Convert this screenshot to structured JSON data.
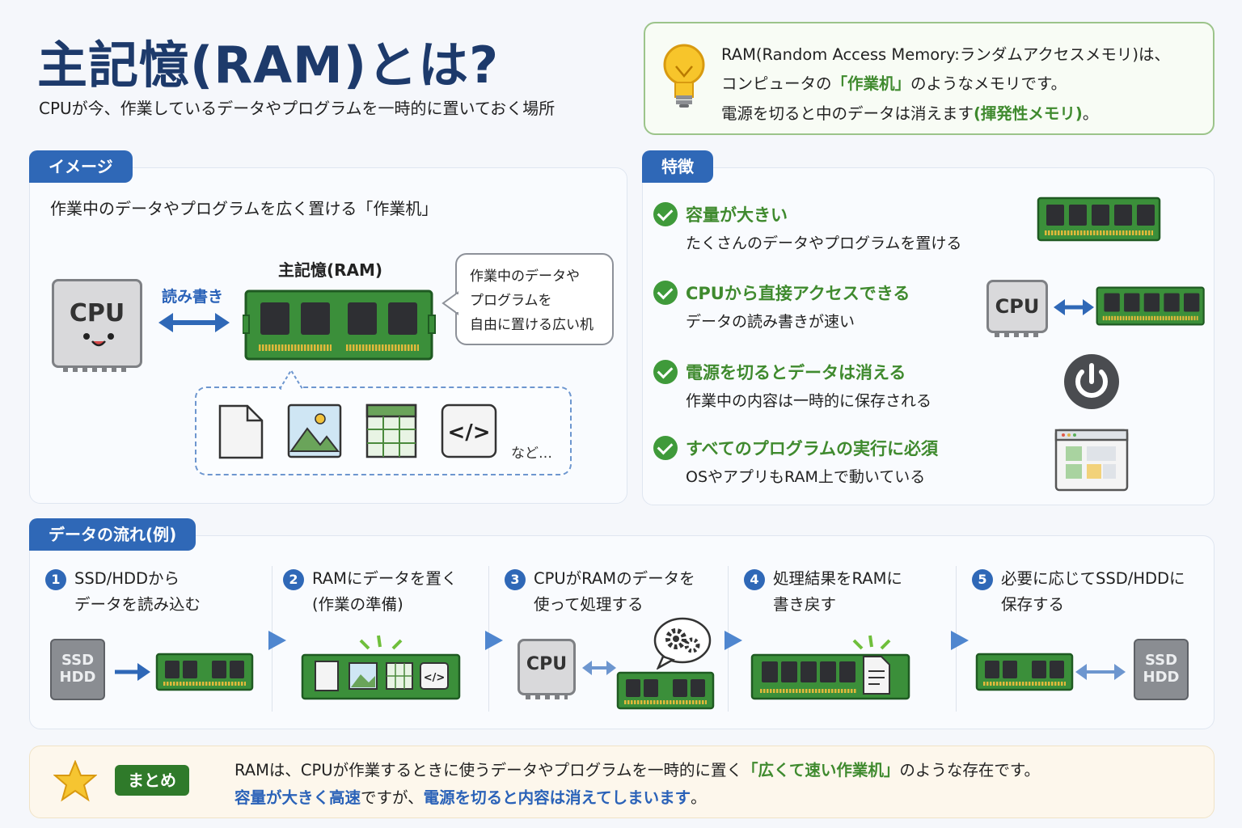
{
  "header": {
    "title": "主記憶(RAM)とは?",
    "subtitle": "CPUが今、作業しているデータやプログラムを一時的に置いておく場所"
  },
  "info": {
    "line1": "RAM(Random Access Memory:ランダムアクセスメモリ)は、",
    "line2_pre": "コンピュータの",
    "line2_em": "「作業机」",
    "line2_post": "のようなメモリです。",
    "line3_pre": "電源を切ると中のデータは消えます",
    "line3_em": "(揮発性メモリ)",
    "line3_post": "。"
  },
  "image_panel": {
    "tag": "イメージ",
    "caption": "作業中のデータやプログラムを広く置ける「作業机」",
    "cpu_label": "CPU",
    "rw_label": "読み書き",
    "ram_label": "主記憶(RAM)",
    "bubble": [
      "作業中のデータや",
      "プログラムを",
      "自由に置ける広い机"
    ],
    "etc": "など…"
  },
  "features": {
    "tag": "特徴",
    "cpu_label": "CPU",
    "items": [
      {
        "title": "容量が大きい",
        "desc": "たくさんのデータやプログラムを置ける"
      },
      {
        "title": "CPUから直接アクセスできる",
        "desc": "データの読み書きが速い"
      },
      {
        "title": "電源を切るとデータは消える",
        "desc": "作業中の内容は一時的に保存される"
      },
      {
        "title": "すべてのプログラムの実行に必須",
        "desc": "OSやアプリもRAM上で動いている"
      }
    ]
  },
  "flow": {
    "tag": "データの流れ(例)",
    "disk_label": [
      "SSD",
      "HDD"
    ],
    "cpu_label": "CPU",
    "steps": [
      {
        "num": "1",
        "line1": "SSD/HDDから",
        "line2": "データを読み込む"
      },
      {
        "num": "2",
        "line1": "RAMにデータを置く",
        "line2": "(作業の準備)"
      },
      {
        "num": "3",
        "line1": "CPUがRAMのデータを",
        "line2": "使って処理する"
      },
      {
        "num": "4",
        "line1": "処理結果をRAMに",
        "line2": "書き戻す"
      },
      {
        "num": "5",
        "line1": "必要に応じてSSD/HDDに",
        "line2": "保存する"
      }
    ]
  },
  "summary": {
    "badge": "まとめ",
    "line1_pre": "RAMは、CPUが作業するときに使うデータやプログラムを一時的に置く",
    "line1_em": "「広くて速い作業机」",
    "line1_post": "のような存在です。",
    "line2_em1": "容量が大きく高速",
    "line2_mid": "ですが、",
    "line2_em2": "電源を切ると内容は消えてしまいます",
    "line2_post": "。"
  },
  "colors": {
    "accent_blue": "#2f68b7",
    "accent_green": "#3f8a2e",
    "ram_green": "#3b8f3a"
  }
}
